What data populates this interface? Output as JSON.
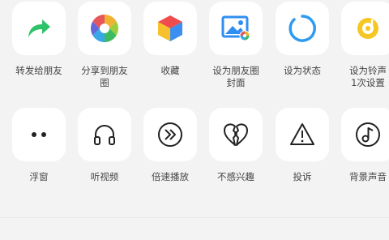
{
  "share_panel": {
    "row1": [
      {
        "label": "转发给朋友",
        "icon": "forward-arrow-icon"
      },
      {
        "label": "分享到朋友\n圈",
        "icon": "moments-aperture-icon"
      },
      {
        "label": "收藏",
        "icon": "favorites-cube-icon"
      },
      {
        "label": "设为朋友圈\n封面",
        "icon": "moments-cover-image-icon"
      },
      {
        "label": "设为状态",
        "icon": "status-ring-icon"
      },
      {
        "label": "设为铃声\n1次设置",
        "icon": "ringtone-icon"
      }
    ],
    "row2": [
      {
        "label": "浮窗",
        "icon": "floating-window-icon"
      },
      {
        "label": "听视频",
        "icon": "headphones-icon"
      },
      {
        "label": "倍速播放",
        "icon": "playback-speed-icon"
      },
      {
        "label": "不感兴趣",
        "icon": "broken-heart-icon"
      },
      {
        "label": "投诉",
        "icon": "warning-triangle-icon"
      },
      {
        "label": "背景声音",
        "icon": "music-note-icon"
      }
    ]
  },
  "colors": {
    "background": "#f3f3f3",
    "tile": "#ffffff",
    "forward_green": "#2ec26a",
    "status_blue": "#2f9bf0",
    "ringtone_yellow": "#f6c623"
  }
}
